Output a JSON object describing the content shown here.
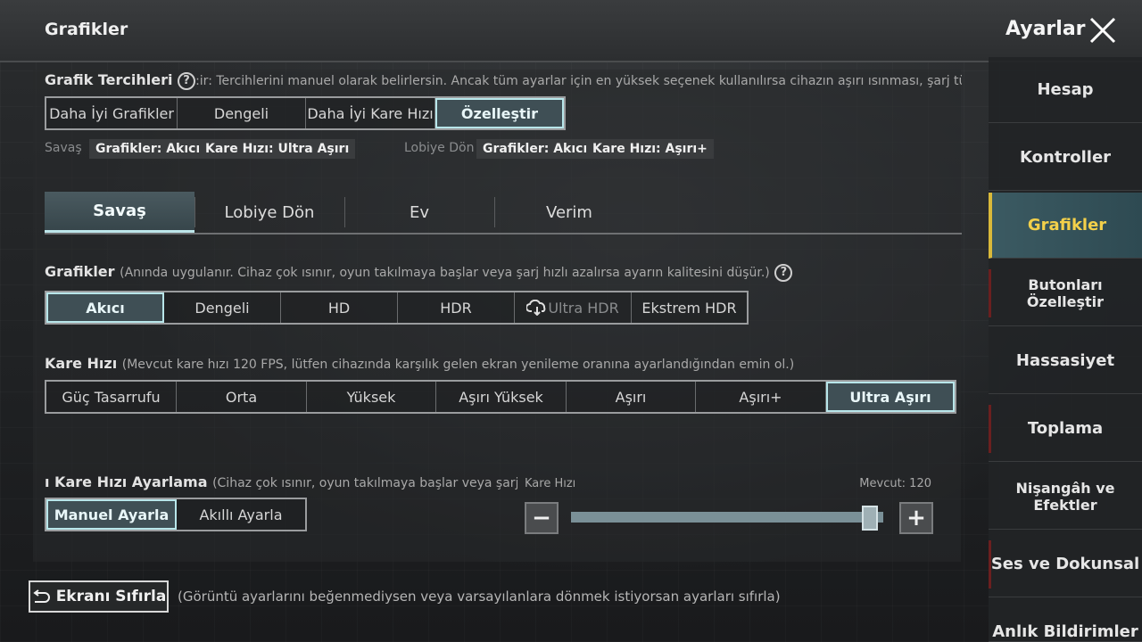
{
  "header": {
    "title": "Grafikler",
    "settings_title": "Ayarlar"
  },
  "graphic_prefs": {
    "label": "Grafik Tercihleri",
    "help": "?",
    "description": ":ir: Tercihlerini manuel olarak belirlersin. Ancak tüm ayarlar için en yüksek seçenek kullanılırsa cihazın aşırı ısınması, şarj tüket",
    "options": [
      "Daha İyi Grafikler",
      "Dengeli",
      "Daha İyi Kare Hızı",
      "Özelleştir"
    ],
    "selected": "Özelleştir"
  },
  "summary": {
    "battle_label": "Savaş",
    "battle_graphics": "Grafikler: Akıcı",
    "battle_fps": "Kare Hızı: Ultra Aşırı",
    "lobby_label": "Lobiye Dön",
    "lobby_graphics": "Grafikler: Akıcı",
    "lobby_fps": "Kare Hızı: Aşırı+"
  },
  "tabs": [
    "Savaş",
    "Lobiye Dön",
    "Ev",
    "Verim"
  ],
  "graphics": {
    "label": "Grafikler",
    "note": "(Anında uygulanır. Cihaz çok ısınır, oyun takılmaya başlar veya şarj hızlı azalırsa ayarın kalitesini düşür.)",
    "help": "?",
    "options": [
      "Akıcı",
      "Dengeli",
      "HD",
      "HDR",
      "Ultra HDR",
      "Ekstrem HDR"
    ],
    "selected": "Akıcı"
  },
  "framerate": {
    "label": "Kare Hızı",
    "note": "(Mevcut kare hızı 120 FPS, lütfen cihazında karşılık gelen ekran yenileme oranına ayarlandığından emin ol.)",
    "options": [
      "Güç Tasarrufu",
      "Orta",
      "Yüksek",
      "Aşırı Yüksek",
      "Aşırı",
      "Aşırı+",
      "Ultra Aşırı"
    ],
    "selected": "Ultra Aşırı"
  },
  "fps_adjust": {
    "label": "ı Kare Hızı Ayarlama",
    "note": "(Cihaz çok ısınır, oyun takılmaya başlar veya şarj hızlı az",
    "options": [
      "Manuel Ayarla",
      "Akıllı Ayarla"
    ],
    "selected": "Manuel Ayarla",
    "slider_label": "Kare Hızı",
    "current_label": "Mevcut: 120",
    "minus": "−",
    "plus": "+",
    "slider_level_fraction": 0.97
  },
  "reset": {
    "label": "Ekranı Sıfırla",
    "note": "(Görüntü ayarlarını beğenmediysen veya varsayılanlara dönmek istiyorsan ayarları sıfırla)"
  },
  "sidebar": {
    "items": [
      "Hesap",
      "Kontroller",
      "Grafikler",
      "Butonları Özelleştir",
      "Hassasiyet",
      "Toplama",
      "Nişangâh ve Efektler",
      "Ses ve Dokunsal",
      "Anlık Bildirimler"
    ],
    "selected": "Grafikler"
  },
  "colors": {
    "accent": "#bde6ea",
    "selected_side_text": "#f3d04a"
  }
}
